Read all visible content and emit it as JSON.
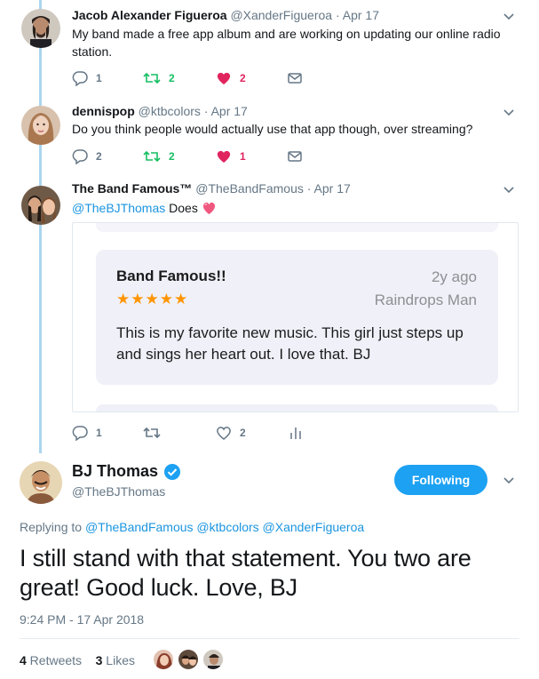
{
  "replies": [
    {
      "name": "Jacob Alexander Figueroa",
      "handle": "@XanderFigueroa",
      "dot": "·",
      "date": "Apr 17",
      "text": "My band made a free app album and are working on updating our online radio station.",
      "reply_count": "1",
      "retweet_count": "2",
      "like_count": "2"
    },
    {
      "name": "dennispop",
      "handle": "@ktbcolors",
      "dot": "·",
      "date": "Apr 17",
      "text": "Do you think people would actually use that app though, over streaming?",
      "reply_count": "2",
      "retweet_count": "2",
      "like_count": "1"
    },
    {
      "name": "The Band Famous™",
      "handle": "@TheBandFamous",
      "dot": "·",
      "date": "Apr 17",
      "mention": "@TheBJThomas",
      "text_after": " Does ",
      "reply_count": "1",
      "like_count": "2",
      "review": {
        "title": "Band Famous!!",
        "age": "2y ago",
        "stars": "★★★★★",
        "author": "Raindrops Man",
        "body": "This is my favorite new music. This girl just steps up and sings her heart out. I love that. BJ"
      }
    }
  ],
  "main": {
    "name": "BJ Thomas",
    "handle": "@TheBJThomas",
    "follow_label": "Following",
    "replying_prefix": "Replying to ",
    "replying_to": "@TheBandFamous @ktbcolors @XanderFigueroa",
    "text": "I still stand with that statement. You two are great!  Good luck. Love, BJ",
    "timestamp": "9:24 PM - 17 Apr 2018",
    "retweets_count": "4",
    "retweets_label": " Retweets",
    "likes_count": "3",
    "likes_label": " Likes"
  },
  "colors": {
    "accent": "#1da1f2",
    "retweet": "#17bf63",
    "like": "#e0245e",
    "thread_line": "#abd5ef",
    "review_stars": "#ff9500"
  }
}
